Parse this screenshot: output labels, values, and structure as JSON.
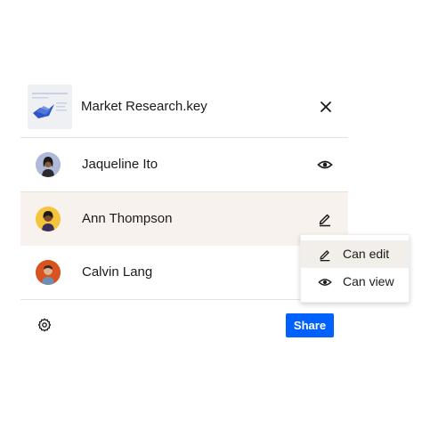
{
  "file": {
    "name": "Market Research.key",
    "thumbnail_icon": "keynote-thumbnail",
    "close_icon": "close-icon"
  },
  "people": [
    {
      "name": "Jaqueline Ito",
      "permission_icon": "eye-icon",
      "avatar_bg": "#aebad8"
    },
    {
      "name": "Ann Thompson",
      "permission_icon": "pencil-icon",
      "avatar_bg": "#f4c53a"
    },
    {
      "name": "Calvin Lang",
      "permission_icon": "",
      "avatar_bg": "#d8531f"
    }
  ],
  "permission_menu": {
    "items": [
      {
        "label": "Can edit",
        "icon": "pencil-icon",
        "selected": true
      },
      {
        "label": "Can view",
        "icon": "eye-icon",
        "selected": false
      }
    ]
  },
  "footer": {
    "settings_icon": "gear-icon",
    "share_label": "Share"
  },
  "colors": {
    "accent": "#0061fe",
    "active_row_bg": "#f7f2ee",
    "divider": "#e5e1dc"
  }
}
